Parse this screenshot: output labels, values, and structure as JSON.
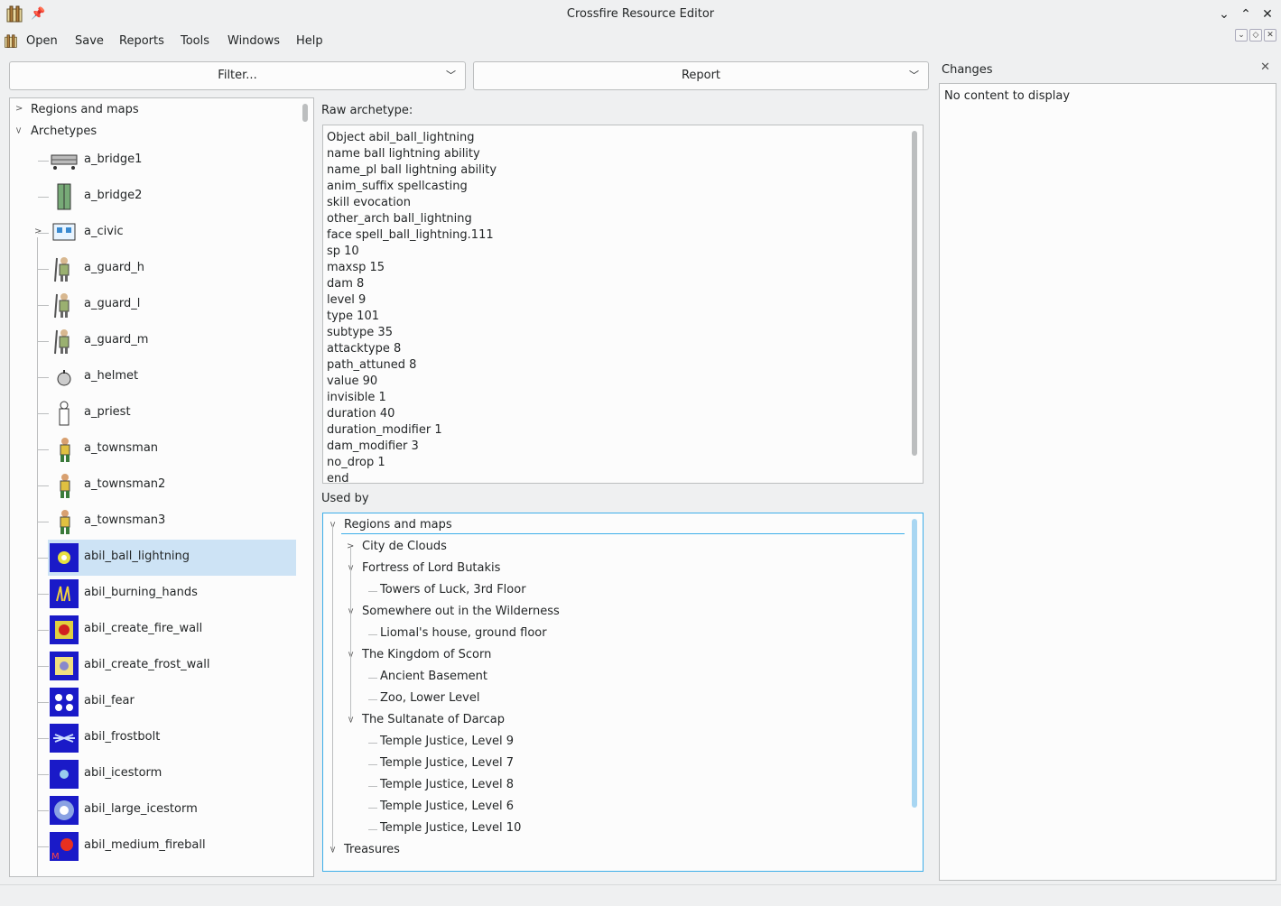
{
  "window": {
    "title": "Crossfire Resource Editor",
    "controls": [
      "chevron-down-icon",
      "chevron-up-icon",
      "close-icon"
    ]
  },
  "menu": {
    "items": [
      "Open",
      "Save",
      "Reports",
      "Tools",
      "Windows",
      "Help"
    ]
  },
  "toolbar": {
    "filter_label": "Filter...",
    "report_label": "Report"
  },
  "left_tree": {
    "roots": [
      "Regions and maps",
      "Archetypes"
    ],
    "archetypes": [
      {
        "label": "a_bridge1",
        "icon": "bridge-horizontal-icon"
      },
      {
        "label": "a_bridge2",
        "icon": "bridge-vertical-icon"
      },
      {
        "label": "a_civic",
        "icon": "civic-icon",
        "expandable": true
      },
      {
        "label": "a_guard_h",
        "icon": "guard-icon"
      },
      {
        "label": "a_guard_l",
        "icon": "guard-icon"
      },
      {
        "label": "a_guard_m",
        "icon": "guard-icon"
      },
      {
        "label": "a_helmet",
        "icon": "helmet-icon"
      },
      {
        "label": "a_priest",
        "icon": "priest-icon"
      },
      {
        "label": "a_townsman",
        "icon": "townsman-icon"
      },
      {
        "label": "a_townsman2",
        "icon": "townsman-icon"
      },
      {
        "label": "a_townsman3",
        "icon": "townsman-icon"
      },
      {
        "label": "abil_ball_lightning",
        "icon": "ball-lightning-icon",
        "selected": true
      },
      {
        "label": "abil_burning_hands",
        "icon": "burning-hands-icon"
      },
      {
        "label": "abil_create_fire_wall",
        "icon": "fire-wall-icon"
      },
      {
        "label": "abil_create_frost_wall",
        "icon": "frost-wall-icon"
      },
      {
        "label": "abil_fear",
        "icon": "fear-icon"
      },
      {
        "label": "abil_frostbolt",
        "icon": "frostbolt-icon"
      },
      {
        "label": "abil_icestorm",
        "icon": "icestorm-icon"
      },
      {
        "label": "abil_large_icestorm",
        "icon": "large-icestorm-icon"
      },
      {
        "label": "abil_medium_fireball",
        "icon": "medium-fireball-icon"
      }
    ]
  },
  "raw": {
    "label": "Raw archetype:",
    "lines": [
      "Object abil_ball_lightning",
      "name ball lightning ability",
      "name_pl ball lightning ability",
      "anim_suffix spellcasting",
      "skill evocation",
      "other_arch ball_lightning",
      "face spell_ball_lightning.111",
      "sp 10",
      "maxsp 15",
      "dam 8",
      "level 9",
      "type 101",
      "subtype 35",
      "attacktype 8",
      "path_attuned 8",
      "value 90",
      "invisible 1",
      "duration 40",
      "duration_modifier 1",
      "dam_modifier 3",
      "no_drop 1",
      "end"
    ]
  },
  "used_by": {
    "label": "Used by",
    "rows": [
      {
        "text": "Regions and maps",
        "level": 0,
        "exp": "open"
      },
      {
        "text": "City de Clouds",
        "level": 1,
        "exp": "closed"
      },
      {
        "text": "Fortress of Lord Butakis",
        "level": 1,
        "exp": "open"
      },
      {
        "text": "Towers of Luck, 3rd Floor",
        "level": 2,
        "exp": ""
      },
      {
        "text": "Somewhere out in the Wilderness",
        "level": 1,
        "exp": "open"
      },
      {
        "text": "Liomal's house, ground floor",
        "level": 2,
        "exp": ""
      },
      {
        "text": "The Kingdom of Scorn",
        "level": 1,
        "exp": "open"
      },
      {
        "text": "Ancient Basement",
        "level": 2,
        "exp": ""
      },
      {
        "text": "Zoo, Lower Level",
        "level": 2,
        "exp": ""
      },
      {
        "text": "The Sultanate of Darcap",
        "level": 1,
        "exp": "open"
      },
      {
        "text": "Temple Justice, Level 9",
        "level": 2,
        "exp": ""
      },
      {
        "text": "Temple Justice, Level 7",
        "level": 2,
        "exp": ""
      },
      {
        "text": "Temple Justice, Level 8",
        "level": 2,
        "exp": ""
      },
      {
        "text": "Temple Justice, Level 6",
        "level": 2,
        "exp": ""
      },
      {
        "text": "Temple Justice, Level 10",
        "level": 2,
        "exp": ""
      },
      {
        "text": "Treasures",
        "level": 0,
        "exp": "open"
      }
    ]
  },
  "changes": {
    "title": "Changes",
    "empty_text": "No content to display"
  },
  "colors": {
    "selection": "#cde3f5",
    "focus_border": "#3daee9",
    "spell_icon_bg": "#1a1ac8"
  }
}
